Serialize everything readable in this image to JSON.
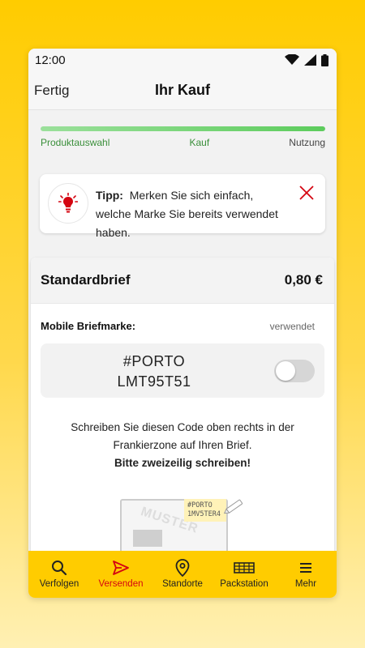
{
  "status_bar": {
    "time": "12:00"
  },
  "header": {
    "done_label": "Fertig",
    "title": "Ihr Kauf"
  },
  "progress": {
    "value": 1.0,
    "steps": [
      "Produktauswahl",
      "Kauf",
      "Nutzung"
    ]
  },
  "tip": {
    "label": "Tipp:",
    "text": "Merken Sie sich einfach, welche Marke Sie bereits verwendet haben."
  },
  "product": {
    "name": "Standardbrief",
    "price": "0,80 €",
    "stamp_label": "Mobile Briefmarke:",
    "stamp_status": "verwendet",
    "code_line1": "#PORTO",
    "code_line2": "LMT95T51",
    "instruction": "Schreiben Sie diesen Code oben rechts in der Frankierzone auf Ihren Brief.",
    "instruction_bold": "Bitte zweizeilig schreiben!",
    "illustration": {
      "muster": "MUSTER",
      "code_line1": "#PORTO",
      "code_line2": "1MV5TER4"
    }
  },
  "tabbar": {
    "items": [
      {
        "label": "Verfolgen",
        "icon": "search-icon"
      },
      {
        "label": "Versenden",
        "icon": "send-icon",
        "active": true
      },
      {
        "label": "Standorte",
        "icon": "location-pin-icon"
      },
      {
        "label": "Packstation",
        "icon": "packstation-icon"
      },
      {
        "label": "Mehr",
        "icon": "menu-icon"
      }
    ]
  },
  "colors": {
    "brand_yellow": "#ffcc00",
    "brand_red": "#d40511",
    "progress_green": "#5ccc5c"
  }
}
